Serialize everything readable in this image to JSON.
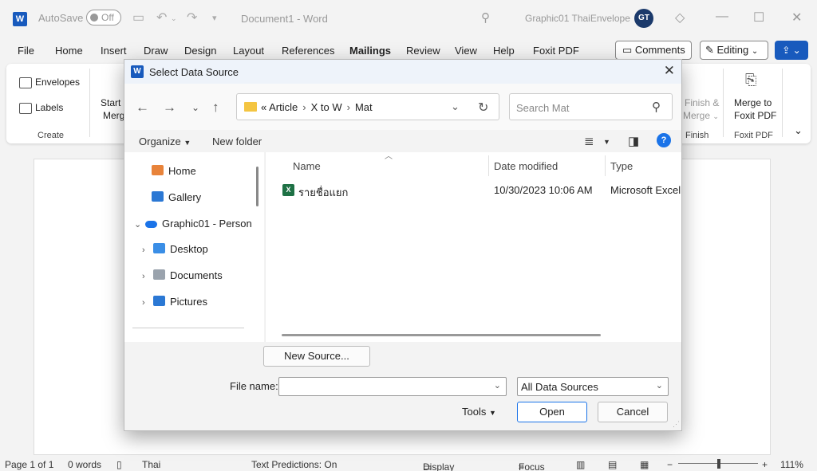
{
  "app": {
    "logo": "W",
    "autosave_label": "AutoSave",
    "autosave_state": "Off",
    "doc_title": "Document1 - Word",
    "user_name": "Graphic01 ThaiEnvelope",
    "avatar_initials": "GT"
  },
  "tabs": [
    "File",
    "Home",
    "Insert",
    "Draw",
    "Design",
    "Layout",
    "References",
    "Mailings",
    "Review",
    "View",
    "Help",
    "Foxit PDF"
  ],
  "active_tab": "Mailings",
  "top_buttons": {
    "comments": "Comments",
    "editing": "Editing"
  },
  "ribbon": {
    "create_group": {
      "envelopes": "Envelopes",
      "labels": "Labels",
      "label": "Create"
    },
    "start_mail_merge": "Start I",
    "start_mail_merge_2": "Merg",
    "finish_merge_1": "Finish &",
    "finish_merge_2": "Merge",
    "finish_group_label": "Finish",
    "merge_to_foxit_1": "Merge to",
    "merge_to_foxit_2": "Foxit PDF",
    "foxit_group_label": "Foxit PDF"
  },
  "status": {
    "page": "Page 1 of 1",
    "words": "0 words",
    "language": "Thai",
    "text_predictions": "Text Predictions: On",
    "display_settings": "Display Settings",
    "focus": "Focus",
    "zoom": "111%"
  },
  "dialog": {
    "title": "Select Data Source",
    "address": {
      "prefix": "«",
      "crumbs": [
        "Article",
        "X to W",
        "Mat"
      ]
    },
    "search_placeholder": "Search Mat",
    "organize": "Organize",
    "new_folder": "New folder",
    "nav_items": [
      {
        "label": "Home"
      },
      {
        "label": "Gallery"
      },
      {
        "label": "Graphic01 - Person"
      },
      {
        "label": "Desktop"
      },
      {
        "label": "Documents"
      },
      {
        "label": "Pictures"
      }
    ],
    "columns": {
      "name": "Name",
      "date": "Date modified",
      "type": "Type"
    },
    "files": [
      {
        "name": "รายชื่อแยก",
        "date": "10/30/2023 10:06 AM",
        "type": "Microsoft Excel W"
      }
    ],
    "new_source": "New Source...",
    "file_name_label": "File name:",
    "file_name_value": "",
    "filter": "All Data Sources",
    "tools": "Tools",
    "open": "Open",
    "cancel": "Cancel"
  },
  "colors": {
    "accent": "#185abd",
    "excel": "#1e7145",
    "folder": "#f4c542"
  }
}
